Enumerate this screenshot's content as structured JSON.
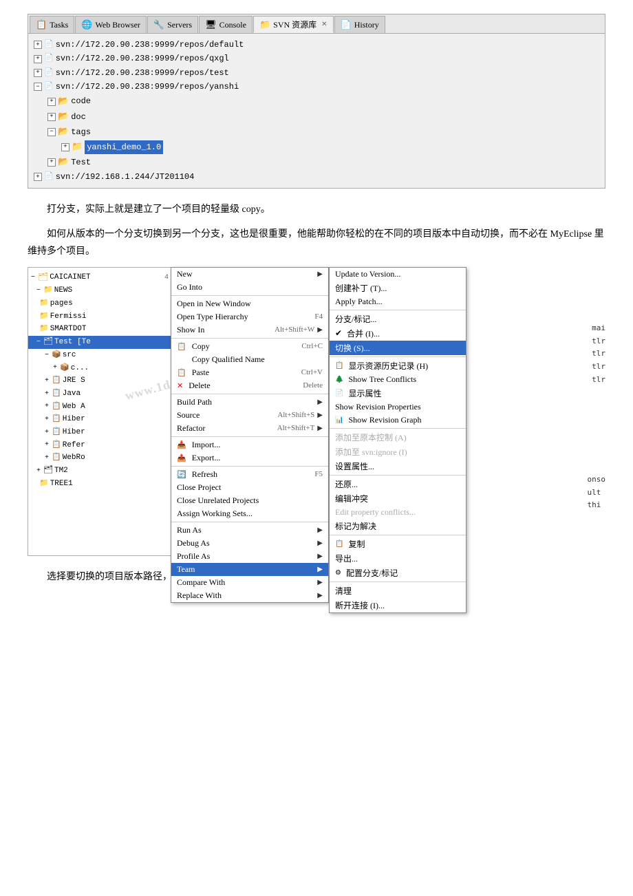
{
  "ide": {
    "tabs": [
      {
        "label": "Tasks",
        "icon": "📋",
        "active": false
      },
      {
        "label": "Web Browser",
        "icon": "🌐",
        "active": false
      },
      {
        "label": "Servers",
        "icon": "🔧",
        "active": false
      },
      {
        "label": "Console",
        "icon": "🖥",
        "active": false
      },
      {
        "label": "SVN 资源库",
        "icon": "📁",
        "active": true,
        "closeable": true
      },
      {
        "label": "History",
        "icon": "📄",
        "active": false
      }
    ],
    "tree_items": [
      {
        "label": "svn://172.20.90.238:9999/repos/default",
        "indent": 0,
        "expanded": false,
        "type": "svn"
      },
      {
        "label": "svn://172.20.90.238:9999/repos/qxgl",
        "indent": 0,
        "expanded": false,
        "type": "svn"
      },
      {
        "label": "svn://172.20.90.238:9999/repos/test",
        "indent": 0,
        "expanded": false,
        "type": "svn"
      },
      {
        "label": "svn://172.20.90.238:9999/repos/yanshi",
        "indent": 0,
        "expanded": true,
        "type": "svn"
      },
      {
        "label": "code",
        "indent": 1,
        "expanded": false,
        "type": "folder"
      },
      {
        "label": "doc",
        "indent": 1,
        "expanded": false,
        "type": "folder"
      },
      {
        "label": "tags",
        "indent": 1,
        "expanded": true,
        "type": "folder"
      },
      {
        "label": "yanshi_demo_1.0",
        "indent": 2,
        "expanded": false,
        "type": "folder",
        "selected": true
      },
      {
        "label": "Test",
        "indent": 1,
        "expanded": false,
        "type": "folder"
      },
      {
        "label": "svn://192.168.1.244/JT201104",
        "indent": 0,
        "expanded": false,
        "type": "svn"
      }
    ]
  },
  "text1": "打分支，实际上就是建立了一个项目的轻量级 copy。",
  "text2": "如何从版本的一个分支切换到另一个分支，这也是很重要，他能帮助你轻松的在不同的项目版本中自动切换，而不必在 MyEclipse 里维持多个项目。",
  "left_tree": {
    "items": [
      {
        "label": "CAICAINET",
        "indent": 0,
        "exp": true,
        "type": "proj"
      },
      {
        "label": "NEWS",
        "indent": 1,
        "exp": false,
        "type": "folder"
      },
      {
        "label": "pages",
        "indent": 1,
        "exp": false,
        "type": "folder"
      },
      {
        "label": "Fermissi",
        "indent": 1,
        "exp": false,
        "type": "folder"
      },
      {
        "label": "SMARTDOT",
        "indent": 1,
        "exp": false,
        "type": "folder"
      },
      {
        "label": "Test [Te",
        "indent": 1,
        "exp": true,
        "type": "proj",
        "selected": true
      },
      {
        "label": "src",
        "indent": 2,
        "exp": true,
        "type": "src"
      },
      {
        "label": "c...",
        "indent": 3,
        "exp": false,
        "type": "pkg"
      },
      {
        "label": "JRE S",
        "indent": 2,
        "exp": false,
        "type": "lib"
      },
      {
        "label": "Java",
        "indent": 2,
        "exp": false,
        "type": "lib"
      },
      {
        "label": "Web A",
        "indent": 2,
        "exp": false,
        "type": "lib"
      },
      {
        "label": "Hiber",
        "indent": 2,
        "exp": false,
        "type": "lib"
      },
      {
        "label": "Hiber",
        "indent": 2,
        "exp": false,
        "type": "lib"
      },
      {
        "label": "Refer",
        "indent": 2,
        "exp": false,
        "type": "lib"
      },
      {
        "label": "WebRo",
        "indent": 2,
        "exp": false,
        "type": "lib"
      },
      {
        "label": "TM2",
        "indent": 1,
        "exp": false,
        "type": "proj"
      },
      {
        "label": "TREE1",
        "indent": 1,
        "exp": false,
        "type": "folder"
      }
    ]
  },
  "main_menu": {
    "items": [
      {
        "label": "New",
        "shortcut": "",
        "has_arrow": true
      },
      {
        "label": "Go Into",
        "shortcut": ""
      },
      {
        "separator": true
      },
      {
        "label": "Open in New Window",
        "shortcut": ""
      },
      {
        "label": "Open Type Hierarchy",
        "shortcut": "F4"
      },
      {
        "label": "Show In",
        "shortcut": "Alt+Shift+W",
        "has_arrow": true
      },
      {
        "separator": true
      },
      {
        "label": "Copy",
        "shortcut": "Ctrl+C",
        "icon": "copy"
      },
      {
        "label": "Copy Qualified Name",
        "shortcut": ""
      },
      {
        "label": "Paste",
        "shortcut": "Ctrl+V",
        "icon": "paste"
      },
      {
        "label": "Delete",
        "shortcut": "Delete",
        "icon": "delete"
      },
      {
        "separator": true
      },
      {
        "label": "Build Path",
        "shortcut": "",
        "has_arrow": true
      },
      {
        "label": "Source",
        "shortcut": "Alt+Shift+S",
        "has_arrow": true
      },
      {
        "label": "Refactor",
        "shortcut": "Alt+Shift+T",
        "has_arrow": true
      },
      {
        "separator": true
      },
      {
        "label": "Import...",
        "shortcut": "",
        "icon": "import"
      },
      {
        "label": "Export...",
        "shortcut": "",
        "icon": "export"
      },
      {
        "separator": true
      },
      {
        "label": "Refresh",
        "shortcut": "F5",
        "icon": "refresh"
      },
      {
        "label": "Close Project",
        "shortcut": ""
      },
      {
        "label": "Close Unrelated Projects",
        "shortcut": ""
      },
      {
        "label": "Assign Working Sets...",
        "shortcut": ""
      },
      {
        "separator": true
      },
      {
        "label": "Run As",
        "shortcut": "",
        "has_arrow": true
      },
      {
        "label": "Debug As",
        "shortcut": "",
        "has_arrow": true
      },
      {
        "label": "Profile As",
        "shortcut": "",
        "has_arrow": true
      },
      {
        "label": "Team",
        "shortcut": "",
        "has_arrow": true,
        "highlighted": true
      },
      {
        "label": "Compare With",
        "shortcut": "",
        "has_arrow": true
      },
      {
        "label": "Replace With",
        "shortcut": "",
        "has_arrow": true
      }
    ]
  },
  "svn_submenu": {
    "items": [
      {
        "label": "Update to Version..."
      },
      {
        "label": "创建补丁 (T)..."
      },
      {
        "label": "Apply Patch..."
      },
      {
        "separator": true
      },
      {
        "label": "分支/标记..."
      },
      {
        "label": "✔ 合并 (I)..."
      },
      {
        "label": "切换 (S)...",
        "highlighted": true
      },
      {
        "separator": true
      },
      {
        "label": "显示资源历史记录 (H)",
        "icon": "history"
      },
      {
        "label": "Show Tree Conflicts",
        "icon": "tree"
      },
      {
        "label": "显示属性",
        "icon": "props"
      },
      {
        "label": "Show Revision Properties"
      },
      {
        "label": "Show Revision Graph",
        "icon": "graph"
      },
      {
        "separator": true
      },
      {
        "label": "添加至原本控制 (A)"
      },
      {
        "label": "添加至 svn:ignore (I)"
      },
      {
        "label": "设置属性..."
      },
      {
        "separator": true
      },
      {
        "label": "还原..."
      },
      {
        "label": "编辑冲突"
      },
      {
        "label": "Edit property conflicts..."
      },
      {
        "label": "标记为解决"
      },
      {
        "separator": true
      },
      {
        "label": "复制",
        "icon": "copy"
      },
      {
        "label": "导出..."
      },
      {
        "label": "配置分支/标记",
        "icon": "config"
      },
      {
        "separator": true
      },
      {
        "label": "清理"
      },
      {
        "label": "断开连接 (I)..."
      }
    ]
  },
  "bottom_text": "选择要切换的项目版本路径，或者直接输入即可。"
}
